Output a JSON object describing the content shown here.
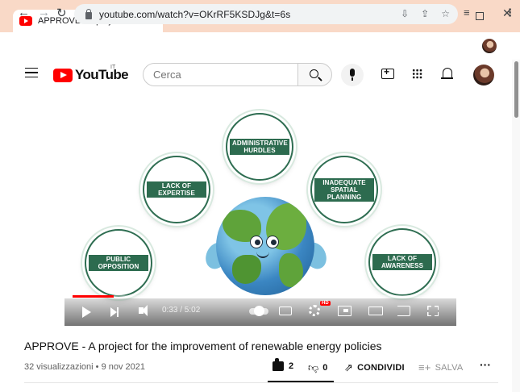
{
  "browser": {
    "tab_title": "APPROVE - A project for the improvement of renewable energy policies",
    "tab_close": "✕",
    "new_tab": "+",
    "window_controls": {
      "chevron": "⌄",
      "minimize": "–",
      "close": "✕"
    },
    "nav": {
      "back": "←",
      "forward": "→",
      "reload": "↻"
    },
    "url": "youtube.com/watch?v=OKrRF5KSDJg&t=6s",
    "omnibox_icons": [
      "⇩",
      "⇪",
      "☆"
    ],
    "toolbar_icons": {
      "queue": "≡",
      "menu": "⋮"
    }
  },
  "youtube": {
    "logo_text": "YouTube",
    "country_code": "IT",
    "search_placeholder": "Cerca"
  },
  "video": {
    "frame_labels": [
      "PUBLIC OPPOSITION",
      "LACK OF EXPERTISE",
      "ADMINISTRATIVE HURDLES",
      "INADEQUATE SPATIAL PLANNING",
      "LACK OF AWARENESS"
    ],
    "current_time": "0:33",
    "duration": "5:02",
    "time_display": "0:33 / 5:02",
    "progress_fraction": 0.109,
    "settings_badge": "HD"
  },
  "info": {
    "title": "APPROVE - A project for the improvement of renewable energy policies",
    "meta": "32 visualizzazioni • 9 nov 2021",
    "likes": "2",
    "dislikes": "0",
    "share_label": "CONDIVIDI",
    "save_label": "SALVA",
    "more": "···"
  },
  "colors": {
    "tabstrip_bg": "#f9d9c7",
    "youtube_red": "#ff0000",
    "label_green": "#2d6b4f"
  }
}
